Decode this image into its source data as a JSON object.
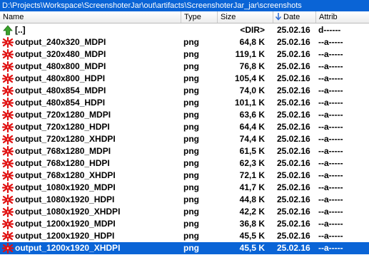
{
  "path": "D:\\Projects\\Workspace\\ScreenshoterJar\\out\\artifacts\\ScreenshoterJar_jar\\screenshots",
  "columns": {
    "name": "Name",
    "type": "Type",
    "size": "Size",
    "date": "Date",
    "attrib": "Attrib"
  },
  "colors": {
    "selection": "#0a64d6",
    "up_arrow": "#3aa12a",
    "file_icon": "#e01010"
  },
  "rows": [
    {
      "name": "[..]",
      "type": "",
      "size": "<DIR>",
      "date": "25.02.16",
      "attrib": "d------",
      "icon": "up-arrow-icon"
    },
    {
      "name": "output_240x320_MDPI",
      "type": "png",
      "size": "64,8 K",
      "date": "25.02.16",
      "attrib": "--a-----",
      "icon": "image-file-icon"
    },
    {
      "name": "output_320x480_MDPI",
      "type": "png",
      "size": "119,1 K",
      "date": "25.02.16",
      "attrib": "--a-----",
      "icon": "image-file-icon"
    },
    {
      "name": "output_480x800_MDPI",
      "type": "png",
      "size": "76,8 K",
      "date": "25.02.16",
      "attrib": "--a-----",
      "icon": "image-file-icon"
    },
    {
      "name": "output_480x800_HDPI",
      "type": "png",
      "size": "105,4 K",
      "date": "25.02.16",
      "attrib": "--a-----",
      "icon": "image-file-icon"
    },
    {
      "name": "output_480x854_MDPI",
      "type": "png",
      "size": "74,0 K",
      "date": "25.02.16",
      "attrib": "--a-----",
      "icon": "image-file-icon"
    },
    {
      "name": "output_480x854_HDPI",
      "type": "png",
      "size": "101,1 K",
      "date": "25.02.16",
      "attrib": "--a-----",
      "icon": "image-file-icon"
    },
    {
      "name": "output_720x1280_MDPI",
      "type": "png",
      "size": "63,6 K",
      "date": "25.02.16",
      "attrib": "--a-----",
      "icon": "image-file-icon"
    },
    {
      "name": "output_720x1280_HDPI",
      "type": "png",
      "size": "64,4 K",
      "date": "25.02.16",
      "attrib": "--a-----",
      "icon": "image-file-icon"
    },
    {
      "name": "output_720x1280_XHDPI",
      "type": "png",
      "size": "74,4 K",
      "date": "25.02.16",
      "attrib": "--a-----",
      "icon": "image-file-icon"
    },
    {
      "name": "output_768x1280_MDPI",
      "type": "png",
      "size": "61,5 K",
      "date": "25.02.16",
      "attrib": "--a-----",
      "icon": "image-file-icon"
    },
    {
      "name": "output_768x1280_HDPI",
      "type": "png",
      "size": "62,3 K",
      "date": "25.02.16",
      "attrib": "--a-----",
      "icon": "image-file-icon"
    },
    {
      "name": "output_768x1280_XHDPI",
      "type": "png",
      "size": "72,1 K",
      "date": "25.02.16",
      "attrib": "--a-----",
      "icon": "image-file-icon"
    },
    {
      "name": "output_1080x1920_MDPI",
      "type": "png",
      "size": "41,7 K",
      "date": "25.02.16",
      "attrib": "--a-----",
      "icon": "image-file-icon"
    },
    {
      "name": "output_1080x1920_HDPI",
      "type": "png",
      "size": "44,8 K",
      "date": "25.02.16",
      "attrib": "--a-----",
      "icon": "image-file-icon"
    },
    {
      "name": "output_1080x1920_XHDPI",
      "type": "png",
      "size": "42,2 K",
      "date": "25.02.16",
      "attrib": "--a-----",
      "icon": "image-file-icon"
    },
    {
      "name": "output_1200x1920_MDPI",
      "type": "png",
      "size": "36,8 K",
      "date": "25.02.16",
      "attrib": "--a-----",
      "icon": "image-file-icon"
    },
    {
      "name": "output_1200x1920_HDPI",
      "type": "png",
      "size": "45,5 K",
      "date": "25.02.16",
      "attrib": "--a-----",
      "icon": "image-file-icon"
    },
    {
      "name": "output_1200x1920_XHDPI",
      "type": "png",
      "size": "45,5 K",
      "date": "25.02.16",
      "attrib": "--a-----",
      "icon": "image-file-icon",
      "selected": true
    }
  ]
}
